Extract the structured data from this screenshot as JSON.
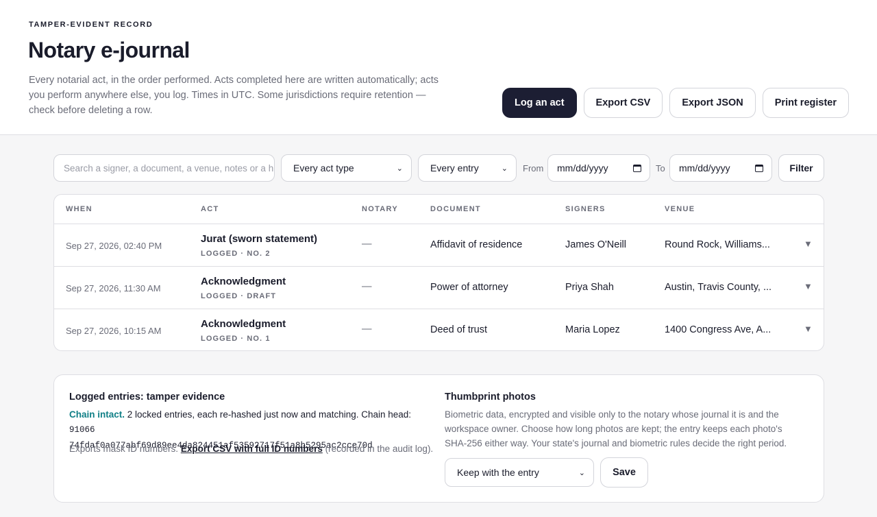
{
  "header": {
    "eyebrow": "TAMPER-EVIDENT RECORD",
    "title": "Notary e-journal",
    "intro": "Every notarial act, in the order performed. Acts completed here are written automatically; acts you perform anywhere else, you log. Times in UTC. Some jurisdictions require retention — check before deleting a row.",
    "actions": {
      "log": "Log an act",
      "csv": "Export CSV",
      "json": "Export JSON",
      "print": "Print register"
    }
  },
  "filters": {
    "search_placeholder": "Search a signer, a document, a venue, notes or a h",
    "act_type": "Every act type",
    "entry": "Every entry",
    "from_label": "From",
    "from_value": "mm/dd/yyyy",
    "to_label": "To",
    "to_value": "mm/dd/yyyy",
    "filter_button": "Filter"
  },
  "table": {
    "columns": [
      "WHEN",
      "ACT",
      "NOTARY",
      "DOCUMENT",
      "SIGNERS",
      "VENUE"
    ],
    "rows": [
      {
        "when": "Sep 27, 2026, 02:40 PM",
        "act": "Jurat (sworn statement)",
        "status": "LOGGED · NO. 2",
        "notary": "—",
        "document": "Affidavit of residence",
        "signers": "James O'Neill",
        "venue": "Round Rock, Williams..."
      },
      {
        "when": "Sep 27, 2026, 11:30 AM",
        "act": "Acknowledgment",
        "status": "LOGGED · DRAFT",
        "notary": "—",
        "document": "Power of attorney",
        "signers": "Priya Shah",
        "venue": "Austin, Travis County, ..."
      },
      {
        "when": "Sep 27, 2026, 10:15 AM",
        "act": "Acknowledgment",
        "status": "LOGGED · NO. 1",
        "notary": "—",
        "document": "Deed of trust",
        "signers": "Maria Lopez",
        "venue": "1400 Congress Ave, A..."
      }
    ],
    "expand_glyph": "▼"
  },
  "tamper": {
    "title": "Logged entries: tamper evidence",
    "status": "Chain intact.",
    "detail": "2 locked entries, each re-hashed just now and matching. Chain head:",
    "hash_part1": "91066",
    "hash_part2": "74fdaf0a077abf69d89ee4da824451af53592717f51a8b5295ac2cce70d",
    "exports_prefix": "Exports mask ID numbers.",
    "exports_link": "Export CSV with full ID numbers",
    "exports_suffix": "(recorded in the audit log)."
  },
  "thumbprint": {
    "title": "Thumbprint photos",
    "body": "Biometric data, encrypted and visible only to the notary whose journal it is and the workspace owner. Choose how long photos are kept; the entry keeps each photo's SHA-256 either way. Your state's journal and biometric rules decide the right period.",
    "retention": "Keep with the entry",
    "save": "Save"
  },
  "colors": {
    "primary": "#1c1e33",
    "accent_ok": "#0f7f86",
    "muted": "#6a6c78"
  }
}
